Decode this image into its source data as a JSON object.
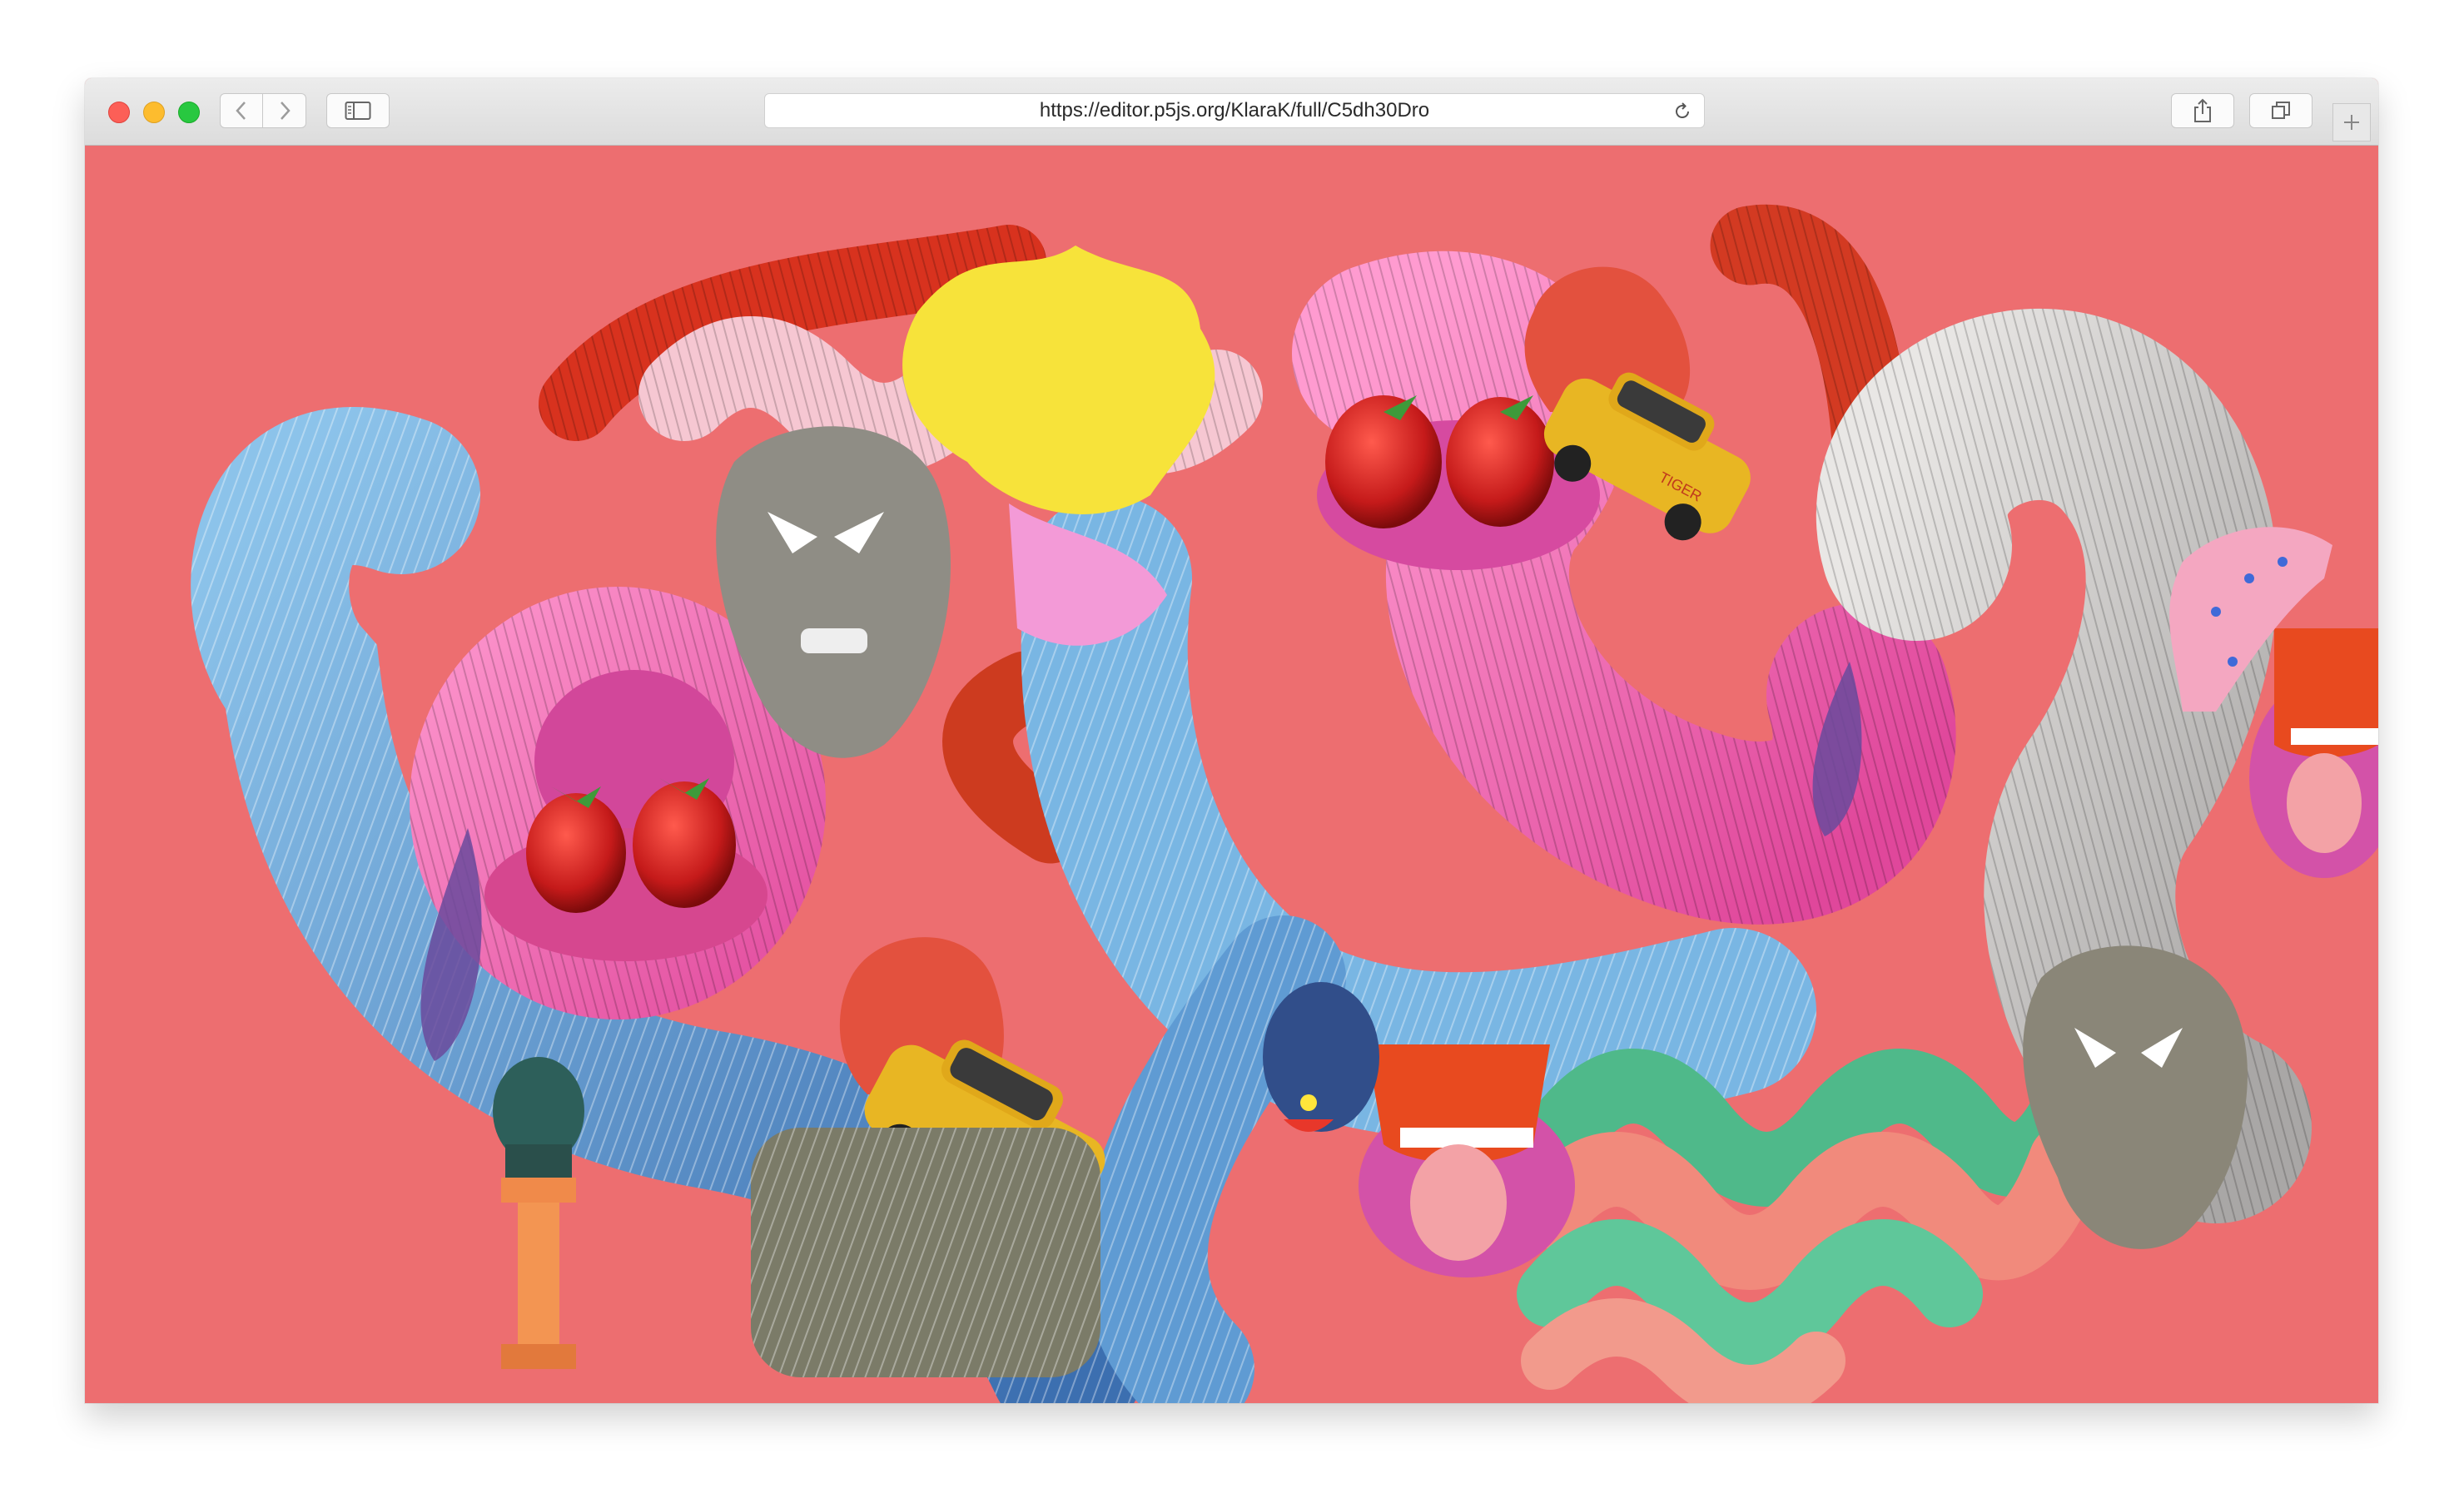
{
  "browser": {
    "url": "https://editor.p5js.org/KlaraK/full/C5dh30Dro",
    "icons": {
      "back": "chevron-left-icon",
      "forward": "chevron-right-icon",
      "sidebar": "sidebar-icon",
      "reload": "reload-icon",
      "share": "share-icon",
      "tabs": "tabs-overview-icon",
      "new_tab": "plus-icon"
    }
  },
  "canvas": {
    "background_color": "#ed6e70",
    "description_objects": [
      "tube-shapes",
      "strawberries",
      "toy-taxi-cars",
      "masks",
      "hands",
      "bust-statue",
      "tongue-mouths",
      "leopard-figure"
    ],
    "car_label": "TIGER"
  },
  "colors": {
    "canvas_bg": "#ed6e70",
    "blue_tube": "#5e9fd2",
    "pink_tube": "#f06bb5",
    "red_tube": "#d8321e",
    "silver_tube": "#c9c7c6",
    "taxi_yellow": "#e8b623"
  }
}
